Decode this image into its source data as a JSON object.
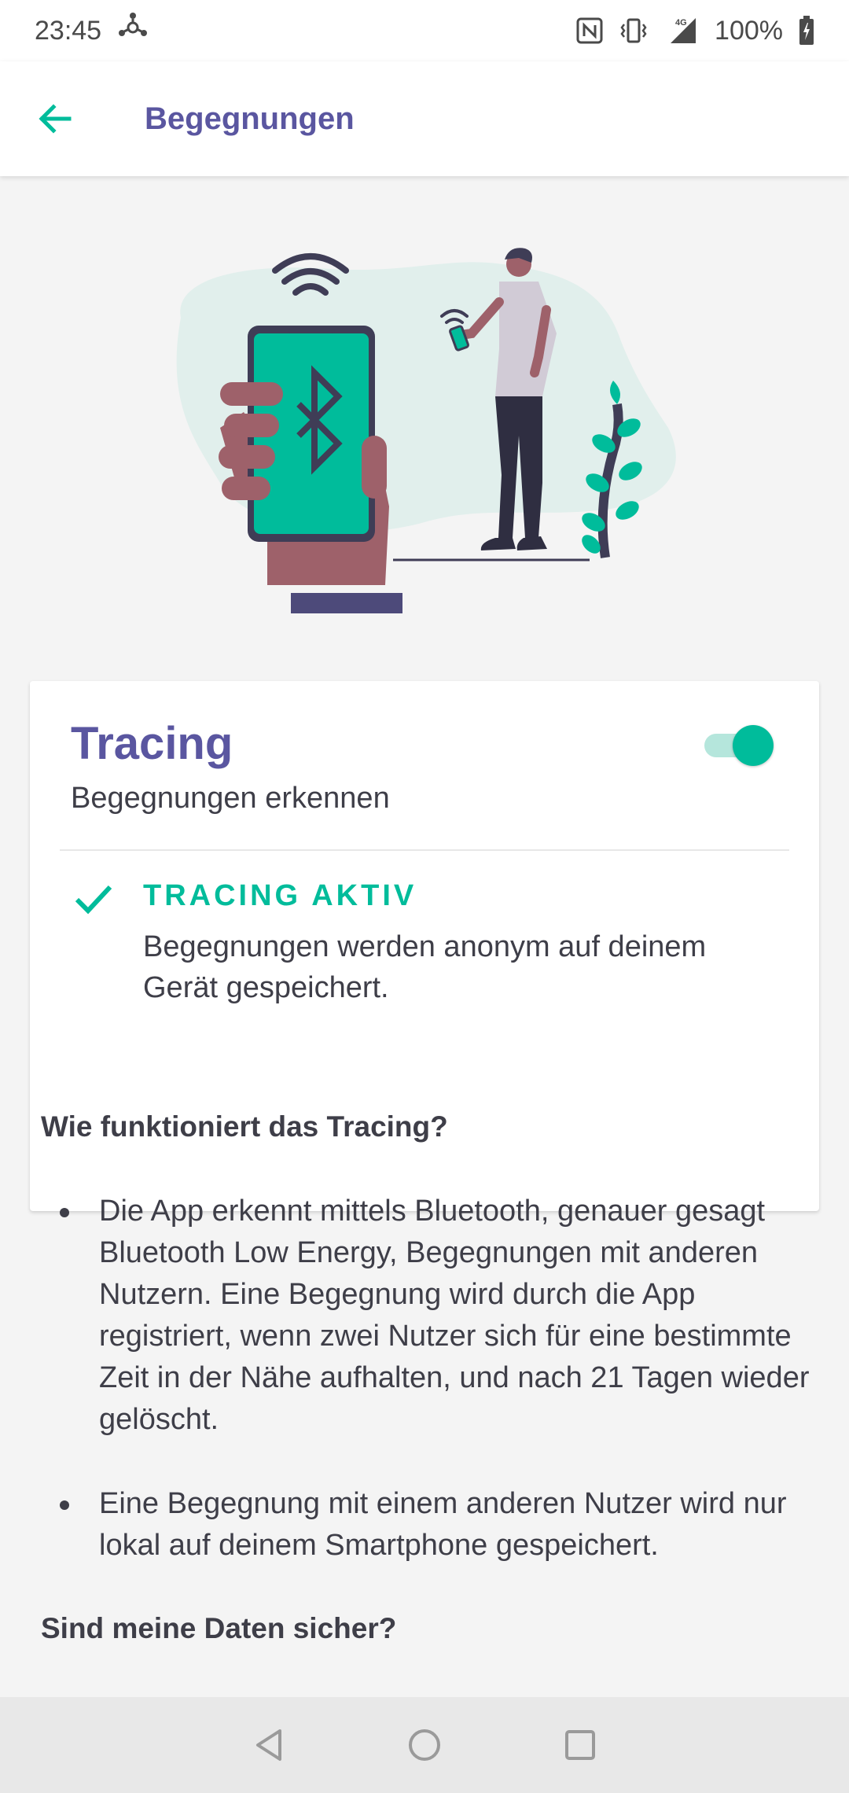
{
  "status_bar": {
    "time": "23:45",
    "network": "4G",
    "battery": "100%",
    "icons": [
      "hub-icon",
      "nfc-icon",
      "vibrate-icon",
      "signal-icon",
      "battery-charging-icon"
    ]
  },
  "app_bar": {
    "title": "Begegnungen",
    "back_icon": "arrow-left-icon"
  },
  "tracing_card": {
    "title": "Tracing",
    "subtitle": "Begegnungen erkennen",
    "toggle_on": true,
    "status_heading": "TRACING AKTIV",
    "status_text": "Begegnungen werden anonym auf deinem Gerät gespeichert."
  },
  "info": {
    "heading_1": "Wie funktioniert das Tracing?",
    "bullets": [
      "Die App erkennt mittels Bluetooth, genauer gesagt Bluetooth Low Energy, Begegnungen mit anderen Nutzern. Eine Begegnung wird durch die App registriert, wenn zwei Nutzer sich für eine bestimmte Zeit in der Nähe aufhalten, und nach 21 Tagen wieder gelöscht.",
      "Eine Begegnung mit einem anderen Nutzer wird nur lokal auf deinem Smartphone gespeichert."
    ],
    "heading_2": "Sind meine Daten sicher?"
  },
  "colors": {
    "primary": "#5a56a0",
    "accent": "#00bc9b",
    "text": "#3e3e48",
    "background": "#f4f4f4"
  },
  "nav_bar": {
    "icons": [
      "nav-back-icon",
      "nav-home-icon",
      "nav-recents-icon"
    ]
  }
}
